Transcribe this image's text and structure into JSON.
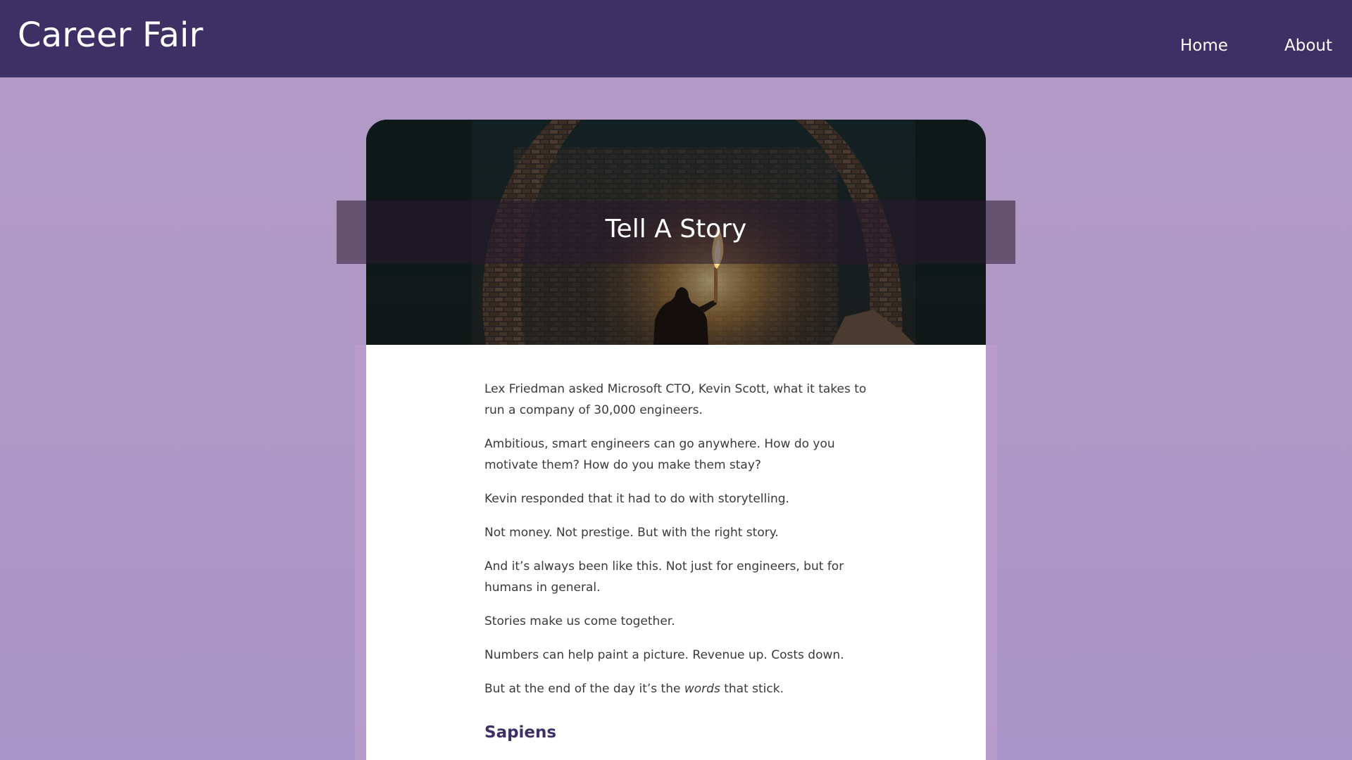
{
  "header": {
    "brand": "Career Fair",
    "nav": [
      {
        "label": "Home"
      },
      {
        "label": "About"
      }
    ]
  },
  "hero": {
    "title": "Tell A Story"
  },
  "article": {
    "paragraphs": [
      "Lex Friedman asked Microsoft CTO, Kevin Scott, what it takes to run a company of 30,000 engineers.",
      "Ambitious, smart engineers can go anywhere. How do you motivate them? How do you make them stay?",
      "Kevin responded that it had to do with storytelling.",
      "Not money. Not prestige. But with the right story.",
      "And it’s always been like this. Not just for engineers, but for humans in general.",
      "Stories make us come together.",
      "Numbers can help paint a picture. Revenue up. Costs down."
    ],
    "closing": {
      "before": "But at the end of the day it’s the ",
      "emphasis": "words",
      "after": " that stick."
    },
    "section_heading": "Sapiens"
  },
  "colors": {
    "header_bg": "#3c3064",
    "page_bg": "#b59bc6",
    "heading_text": "#3c3064"
  },
  "icons": []
}
